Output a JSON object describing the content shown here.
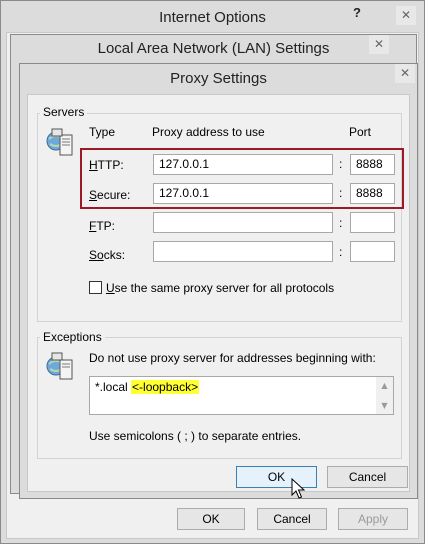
{
  "internet_options": {
    "title": "Internet Options",
    "help_label": "?",
    "close_label": "✕",
    "ok_label": "OK",
    "cancel_label": "Cancel",
    "apply_label": "Apply"
  },
  "lan_settings": {
    "title": "Local Area Network (LAN) Settings",
    "close_label": "✕"
  },
  "proxy_settings": {
    "title": "Proxy Settings",
    "close_label": "✕",
    "servers": {
      "legend": "Servers",
      "col_type": "Type",
      "col_address": "Proxy address to use",
      "col_port": "Port",
      "separator": ":",
      "rows": [
        {
          "label_key": "H",
          "label_rest": "TTP:",
          "address": "127.0.0.1",
          "port": "8888"
        },
        {
          "label_key": "S",
          "label_rest": "ecure:",
          "address": "127.0.0.1",
          "port": "8888"
        },
        {
          "label_key": "F",
          "label_rest": "TP:",
          "address": "",
          "port": ""
        },
        {
          "label_key": "So",
          "label_rest": "cks:",
          "address": "",
          "port": ""
        }
      ],
      "same_proxy_key": "U",
      "same_proxy_rest": "se the same proxy server for all protocols",
      "same_proxy_checked": false
    },
    "exceptions": {
      "legend": "Exceptions",
      "description": "Do not use proxy server for addresses beginning with:",
      "value_prefix": "*.local ",
      "value_highlight": "<-loopback>",
      "note": "Use semicolons ( ; ) to separate entries."
    },
    "ok_label": "OK",
    "cancel_label": "Cancel"
  },
  "colors": {
    "highlight_border": "#9c1a26",
    "highlight_text_bg": "#ffff33",
    "default_button_border": "#3c7fb1"
  },
  "icons": [
    "help-icon",
    "close-icon",
    "network-server-icon",
    "computer-icon",
    "scroll-up-icon",
    "scroll-down-icon",
    "mouse-cursor-icon"
  ]
}
